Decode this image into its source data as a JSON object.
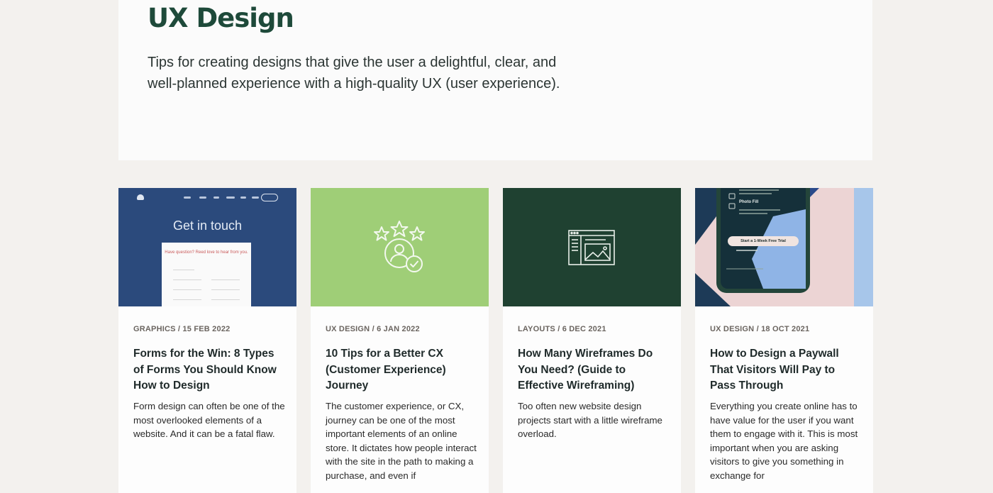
{
  "hero": {
    "title": "UX Design",
    "description": "Tips for creating designs that give the user a delightful, clear, and well-planned experience with a high-quality UX (user experience)."
  },
  "cards": [
    {
      "meta": "GRAPHICS / 15 FEB 2022",
      "title": "Forms for the Win: 8 Types of Forms You Should Know How to Design",
      "excerpt": "Form design can often be one of the most overlooked elements of a website. And it can be a fatal flaw.",
      "thumb_heading": "Get in touch",
      "thumb_form_text": "Have question? Reed love to hear from you."
    },
    {
      "meta": "UX DESIGN / 6 JAN 2022",
      "title": "10 Tips for a Better CX (Customer Experience) Journey",
      "excerpt": "The customer experience, or CX, journey can be one of the most important elements of an online store. It dictates how people interact with the site in the path to making a purchase, and even if",
      "thumb_icon": "star-rating-user-icon"
    },
    {
      "meta": "LAYOUTS / 6 DEC 2021",
      "title": "How Many Wireframes Do You Need? (Guide to Effective Wireframing)",
      "excerpt": "Too often new website design projects start with a little wireframe overload.",
      "thumb_icon": "wireframe-window-icon"
    },
    {
      "meta": "UX DESIGN / 18 OCT 2021",
      "title": "How to Design a Paywall That Visitors Will Pay to Pass Through",
      "excerpt": "Everything you create online has to have value for the user if you want them to engage with it. This is most important when you are asking visitors to give you something in exchange for",
      "thumb_label": "Photo Fill",
      "thumb_button": "Start a 1-Week Free Trial"
    }
  ],
  "colors": {
    "page_bg": "#f3f1ee",
    "hero_title": "#1e4a3a",
    "card1_thumb": "#2b4a7c",
    "card2_thumb": "#9fce77",
    "card3_thumb": "#1f4131",
    "card4_thumb_pink": "#ecd4d4",
    "card4_thumb_blue": "#a7c6ea"
  }
}
